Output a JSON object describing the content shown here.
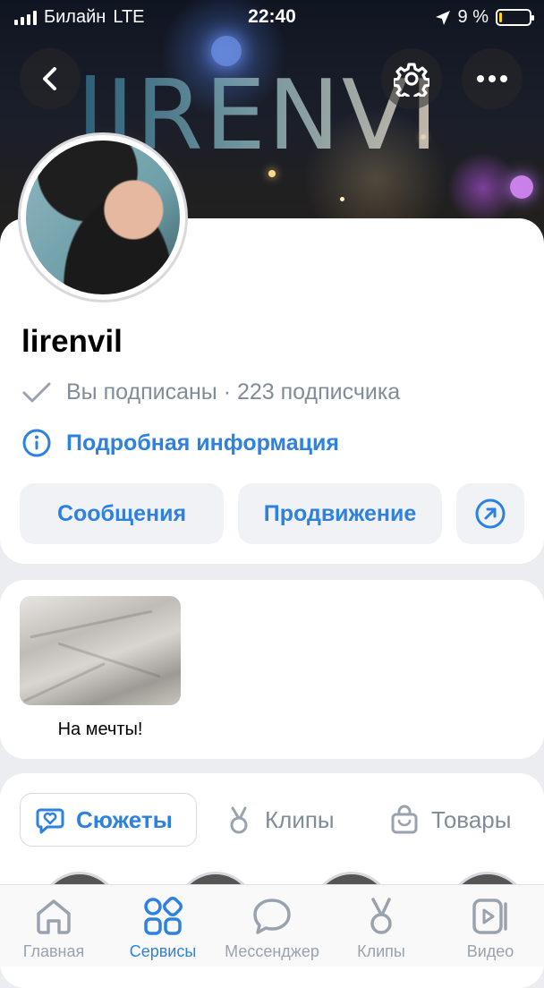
{
  "status_bar": {
    "carrier": "Билайн",
    "network": "LTE",
    "time": "22:40",
    "battery_percent_label": "9 %",
    "battery_level": 0.09
  },
  "cover": {
    "text": "lIRENVI"
  },
  "header": {
    "back_icon": "chevron-left-icon",
    "settings_icon": "gear-icon",
    "more_icon": "more-horizontal-icon"
  },
  "profile": {
    "username": "lirenvil",
    "subscription_status": "Вы подписаны · 223 подписчика",
    "details_link": "Подробная информация",
    "buttons": {
      "messages": "Сообщения",
      "promotion": "Продвижение",
      "share_icon": "arrow-up-right-circle-icon"
    }
  },
  "photos": {
    "caption": "На мечты!"
  },
  "tabs": [
    {
      "label": "Сюжеты",
      "icon": "heart-chat-icon",
      "active": true
    },
    {
      "label": "Клипы",
      "icon": "clips-icon",
      "active": false
    },
    {
      "label": "Товары",
      "icon": "shopping-bag-icon",
      "active": false
    }
  ],
  "bottom_nav": [
    {
      "label": "Главная",
      "icon": "home-icon",
      "active": false
    },
    {
      "label": "Сервисы",
      "icon": "services-grid-icon",
      "active": true
    },
    {
      "label": "Мессенджер",
      "icon": "chat-bubble-icon",
      "active": false
    },
    {
      "label": "Клипы",
      "icon": "clips-icon",
      "active": false
    },
    {
      "label": "Видео",
      "icon": "video-icon",
      "active": false
    }
  ],
  "colors": {
    "accent": "#2d81e0",
    "secondary_text": "#818c99",
    "pill_bg": "#f0f2f5",
    "page_bg": "#ebedf0"
  }
}
